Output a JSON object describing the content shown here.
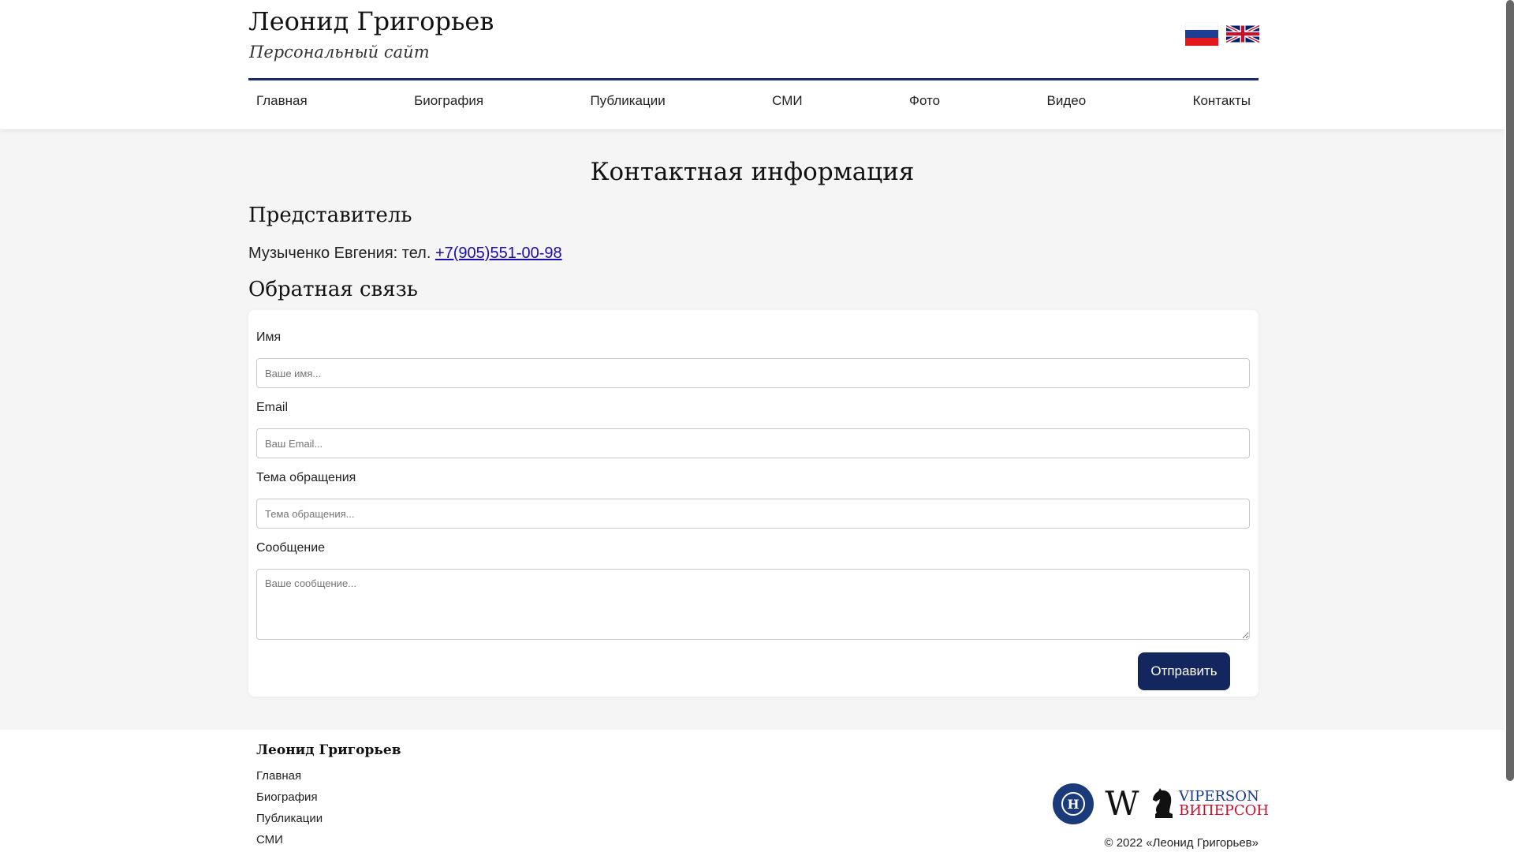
{
  "header": {
    "title": "Леонид Григорьев",
    "subtitle": "Персональный сайт",
    "flags": [
      {
        "icon": "russian-flag-icon",
        "colors": [
          "#ffffff",
          "#1c3f94",
          "#e4181c"
        ]
      },
      {
        "icon": "uk-flag-icon",
        "colors": [
          "#012169",
          "#ffffff",
          "#c8102e"
        ]
      }
    ],
    "nav": [
      "Главная",
      "Биография",
      "Публикации",
      "СМИ",
      "Фото",
      "Видео",
      "Контакты"
    ],
    "accent": "#1a2a6c"
  },
  "main": {
    "title": "Контактная информация",
    "representative": {
      "heading": "Представитель",
      "text": "Музыченко Евгения: тел. ",
      "phone": "+7(905)551-00-98"
    },
    "feedback": {
      "heading": "Обратная связь",
      "fields": [
        {
          "label": "Имя",
          "placeholder": "Ваше имя...",
          "value": ""
        },
        {
          "label": "Email",
          "placeholder": "Ваш Email...",
          "value": ""
        },
        {
          "label": "Тема обращения",
          "placeholder": "Тема обращения...",
          "value": ""
        },
        {
          "label": "Сообщение",
          "placeholder": "Ваше сообщение...",
          "value": ""
        }
      ],
      "submit_label": "Отправить",
      "submit_color": "#14265e"
    }
  },
  "footer": {
    "name": "Леонид Григорьев",
    "links": [
      "Главная",
      "Биография",
      "Публикации",
      "СМИ"
    ],
    "logos": {
      "hse": "hse-logo-icon",
      "wiki_letter": "W",
      "viperson_en": "VIPERSON",
      "viperson_ru": "ВИПЕРСОН"
    },
    "copyright": "© 2022 «Леонид Григорьев»"
  }
}
